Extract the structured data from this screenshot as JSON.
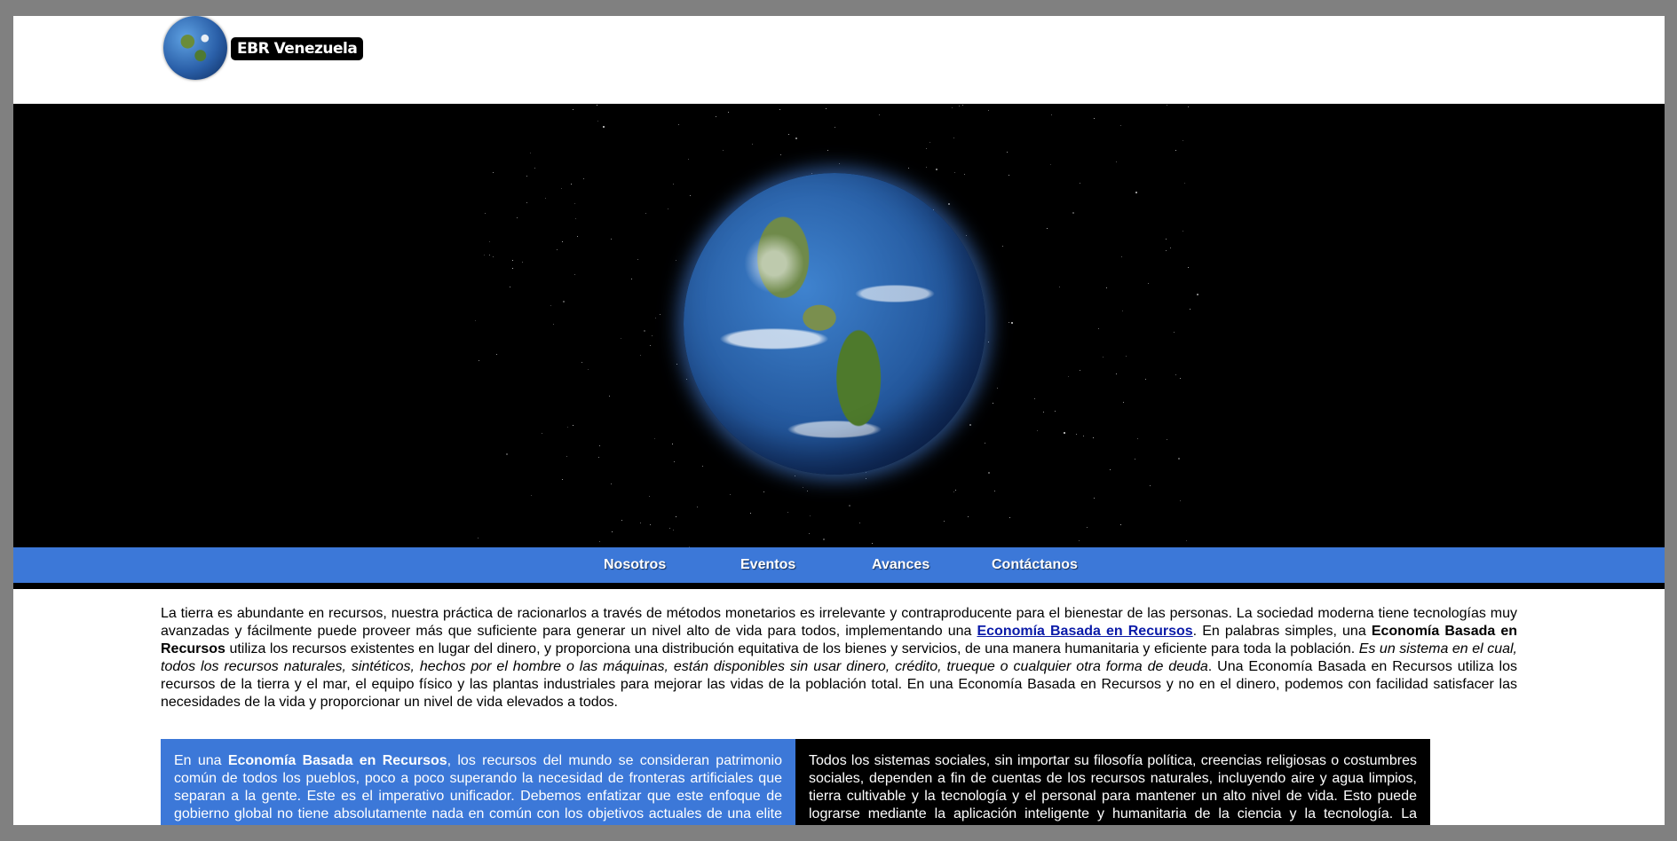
{
  "logo": {
    "text": "EBR Venezuela"
  },
  "nav": {
    "items": [
      {
        "label": "Nosotros"
      },
      {
        "label": "Eventos"
      },
      {
        "label": "Avances"
      },
      {
        "label": "Contáctanos"
      }
    ]
  },
  "intro": {
    "p1": "La tierra es abundante en recursos, nuestra práctica de racionarlos a través de métodos monetarios es irrelevante y contraproducente para el bienestar de las personas. La sociedad moderna tiene tecnologías muy avanzadas y fácilmente puede proveer más que suficiente para generar un nivel alto de vida para todos, implementando una ",
    "link": "Economía Basada en Recursos",
    "p2": ". En palabras simples, una ",
    "bold1": "Economía Basada en Recursos",
    "p3": " utiliza los recursos existentes en lugar del dinero, y proporciona una distribución equitativa de los bienes y servicios, de una manera humanitaria y eficiente para toda la población. ",
    "italic": "Es un sistema en el cual, todos los recursos naturales, sintéticos, hechos por el hombre o las máquinas, están disponibles sin usar dinero, crédito, trueque o cualquier otra forma de deuda",
    "p4": ". Una Economía Basada en Recursos utiliza los recursos de la tierra y el mar, el equipo físico y las plantas industriales para mejorar las vidas de la población total. En una Economía Basada en Recursos y no en el dinero, podemos con facilidad satisfacer las necesidades de la vida y proporcionar un nivel de vida elevados a todos."
  },
  "col_left": {
    "prefix": "En una ",
    "bold": "Economía Basada en Recursos",
    "rest": ", los recursos del mundo se consideran patrimonio común de todos los pueblos, poco a poco superando la necesidad de fronteras artificiales que separan a la gente. Este es el imperativo unificador. Debemos enfatizar que este enfoque de gobierno global no tiene absolutamente nada en común con los objetivos actuales de una elite para formar un gobierno mundial, con ellos mismos y las grandes corporaciones en la cima y la"
  },
  "col_right": {
    "text": "Todos los sistemas sociales, sin importar su filosofía política, creencias religiosas o costumbres sociales, dependen a fin de cuentas de los recursos naturales, incluyendo aire y agua limpios, tierra cultivable y la tecnología y el personal para mantener un alto nivel de vida. Esto puede lograrse mediante la aplicación inteligente y humanitaria de la ciencia y la tecnología. La verdadera riqueza de cualquier nación yace en los recursos desarrollados y potenciales, y en la"
  },
  "colors": {
    "frame": "#808080",
    "nav_bg": "#3c78d8",
    "hero_bg": "#000000",
    "link": "#0a1aa8"
  }
}
